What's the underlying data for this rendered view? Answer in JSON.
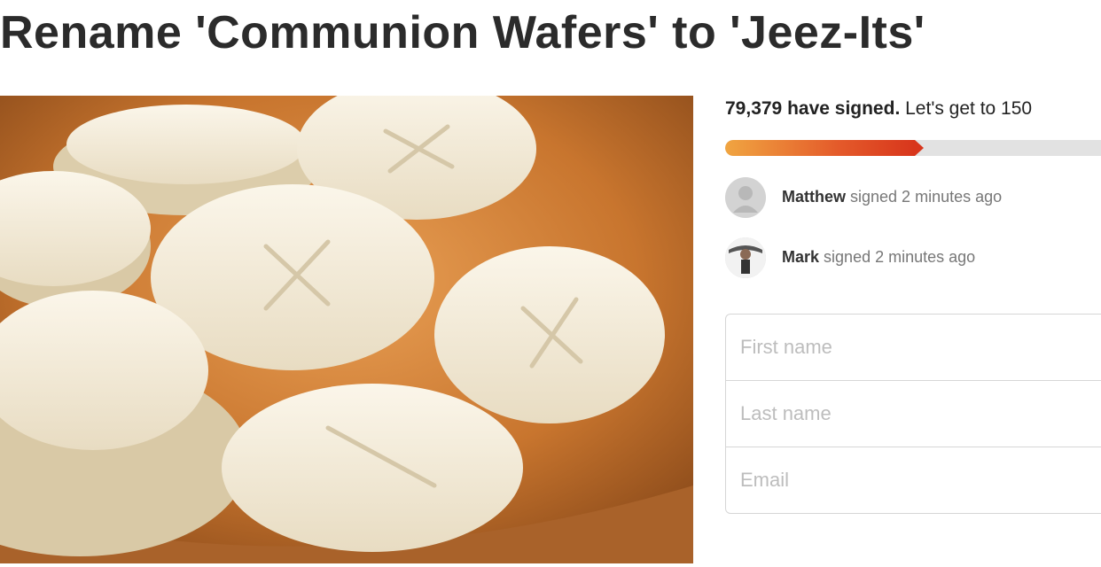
{
  "petition": {
    "title": "Rename 'Communion Wafers' to 'Jeez-Its'"
  },
  "photo": {
    "description_icon": "communion-wafers-bowl-photo"
  },
  "signatures": {
    "count_label": "79,379 have signed.",
    "goal_label": "Let's get to 150",
    "progress_fraction": 0.529,
    "progress_colors": {
      "start": "#f0a541",
      "end": "#d8361c",
      "track": "#e2e2e2"
    }
  },
  "recent_signers": [
    {
      "name": "Matthew",
      "action": "signed 2 minutes ago",
      "avatar_icon": "default-user-icon"
    },
    {
      "name": "Mark",
      "action": "signed 2 minutes ago",
      "avatar_icon": "user-photo-avatar"
    }
  ],
  "form": {
    "first_name": {
      "placeholder": "First name",
      "value": ""
    },
    "last_name": {
      "placeholder": "Last name",
      "value": ""
    },
    "email": {
      "placeholder": "Email",
      "value": ""
    }
  }
}
